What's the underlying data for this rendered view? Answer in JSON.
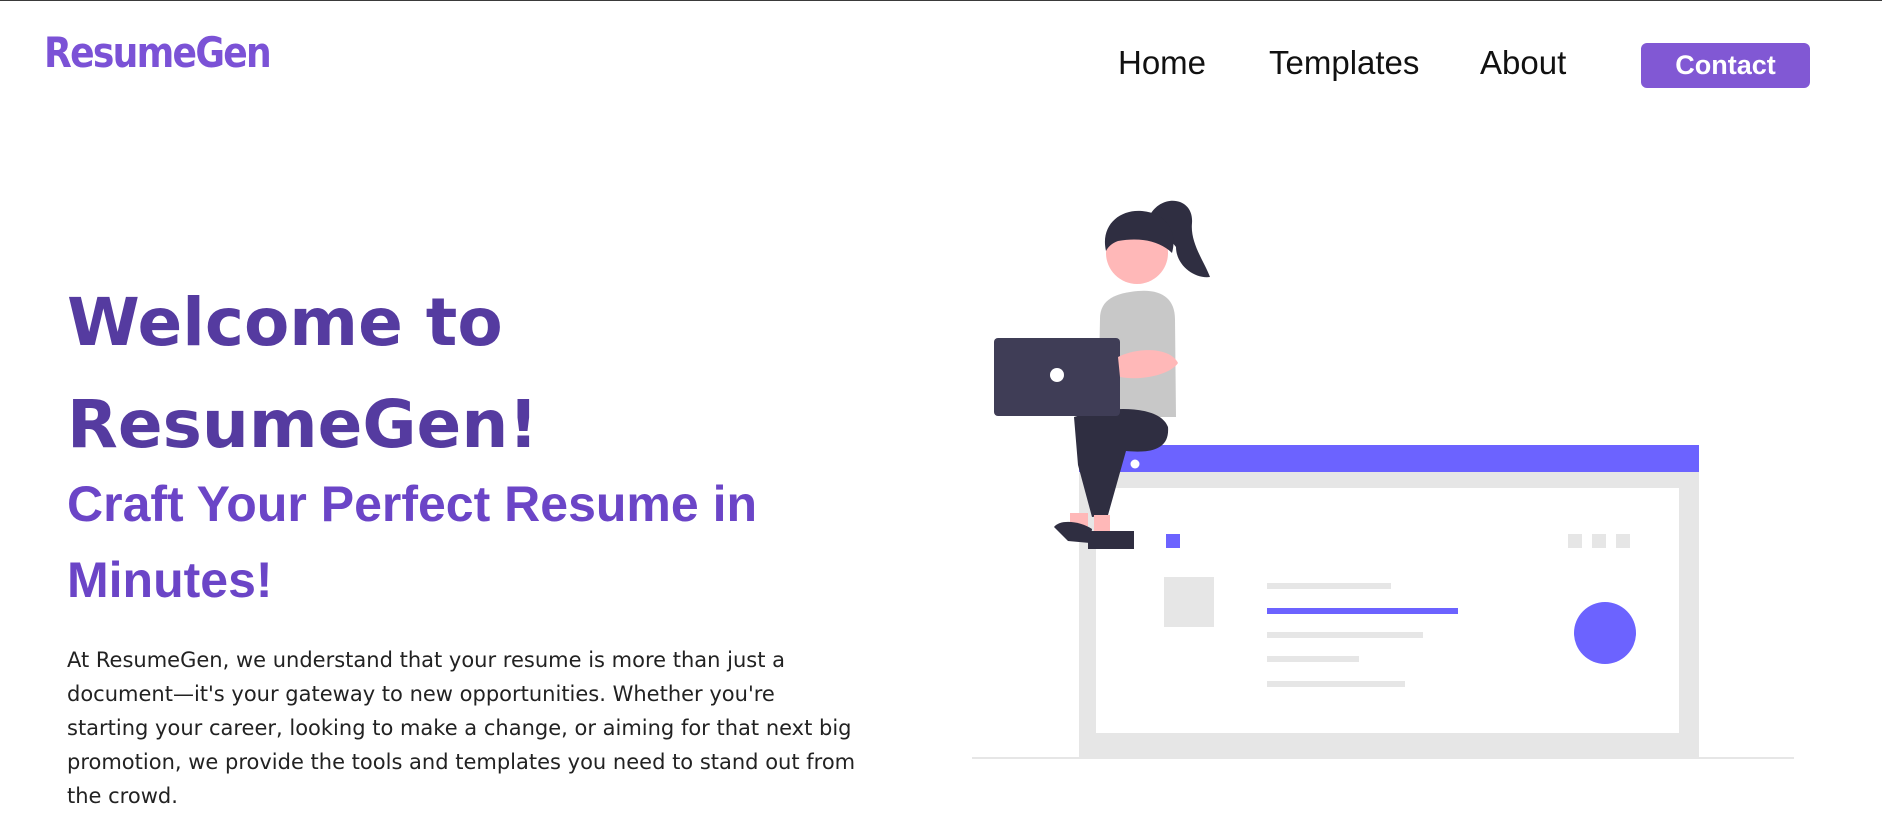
{
  "header": {
    "logo": "ResumeGen",
    "nav": [
      {
        "label": "Home"
      },
      {
        "label": "Templates"
      },
      {
        "label": "About"
      }
    ],
    "contact_label": "Contact"
  },
  "hero": {
    "welcome": "Welcome to ResumeGen!",
    "tagline": "Craft Your Perfect Resume in Minutes!",
    "description": "At ResumeGen, we understand that your resume is more than just a document—it's your gateway to new opportunities. Whether you're starting your career, looking to make a change, or aiming for that next big promotion, we provide the tools and templates you need to stand out from the crowd."
  },
  "colors": {
    "brand": "#7b52d6",
    "heading": "#553ba0",
    "tagline": "#6b45c7",
    "accent": "#6c63ff",
    "button": "#8158d4"
  },
  "illustration": {
    "name": "woman-on-browser-illustration"
  }
}
